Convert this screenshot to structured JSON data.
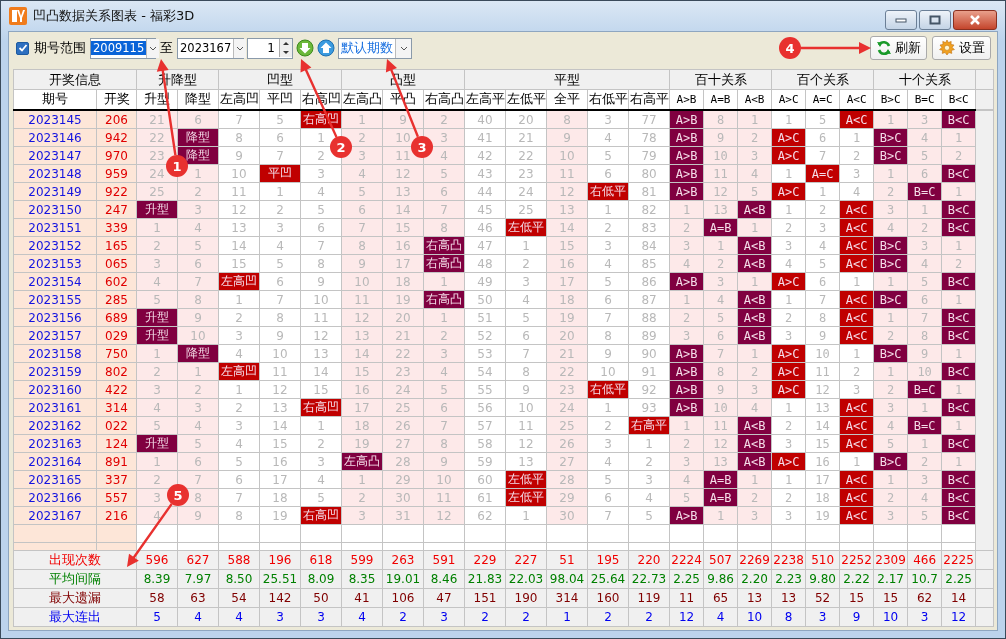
{
  "window": {
    "title": "凹凸数据关系图表 - 福彩3D"
  },
  "toolbar": {
    "range_enabled": true,
    "range_label": "期号范围",
    "start": {
      "value": "2009115",
      "highlighted": true
    },
    "to_label": "至",
    "end": {
      "value": "2023167"
    },
    "step": "1",
    "preset": "默认期数",
    "buttons": [
      {
        "label": "刷新",
        "kind": "refresh"
      },
      {
        "label": "设置",
        "kind": "settings"
      }
    ]
  },
  "table": {
    "groups": [
      {
        "label": "开奖信息",
        "kind": "info",
        "columns": [
          {
            "label": "期号",
            "shaded": true
          },
          {
            "label": "开奖",
            "shaded": true
          }
        ]
      },
      {
        "label": "升降型",
        "kind": "pattern",
        "color": "#800040",
        "columns": [
          {
            "label": "升型",
            "shaded": true
          },
          {
            "label": "降型",
            "shaded": true
          }
        ]
      },
      {
        "label": "凹型",
        "kind": "pattern",
        "color": "#c00000",
        "columns": [
          {
            "label": "左高凹",
            "shaded": false
          },
          {
            "label": "平凹",
            "shaded": false
          },
          {
            "label": "右高凹",
            "shaded": false
          }
        ]
      },
      {
        "label": "凸型",
        "kind": "pattern",
        "color": "#800040",
        "columns": [
          {
            "label": "左高凸",
            "shaded": true
          },
          {
            "label": "平凸",
            "shaded": true
          },
          {
            "label": "右高凸",
            "shaded": true
          }
        ]
      },
      {
        "label": "平型",
        "kind": "pattern",
        "color": "#c00000",
        "columns": [
          {
            "label": "左高平",
            "shaded": false
          },
          {
            "label": "左低平",
            "shaded": false
          },
          {
            "label": "全平",
            "shaded": true
          },
          {
            "label": "右低平",
            "shaded": false
          },
          {
            "label": "右高平",
            "shaded": false
          }
        ]
      },
      {
        "label": "百十关系",
        "kind": "pattern",
        "color": "#800040",
        "columns": [
          {
            "label": "A>B",
            "shaded": true
          },
          {
            "label": "A=B",
            "shaded": true
          },
          {
            "label": "A<B",
            "shaded": true
          }
        ]
      },
      {
        "label": "百个关系",
        "kind": "pattern",
        "color": "#c00000",
        "columns": [
          {
            "label": "A>C",
            "shaded": false
          },
          {
            "label": "A=C",
            "shaded": false
          },
          {
            "label": "A<C",
            "shaded": false
          }
        ]
      },
      {
        "label": "十个关系",
        "kind": "pattern",
        "color": "#800040",
        "columns": [
          {
            "label": "B>C",
            "shaded": true
          },
          {
            "label": "B=C",
            "shaded": true
          },
          {
            "label": "B<C",
            "shaded": true
          }
        ]
      }
    ],
    "rows": [
      {
        "period": "2023145",
        "draw": "206",
        "cells": [
          "21",
          "6",
          "7",
          "5",
          "右高凹",
          "1",
          "9",
          "2",
          "40",
          "20",
          "8",
          "3",
          "77",
          "A>B",
          "8",
          "1",
          "1",
          "5",
          "A<C",
          "1",
          "3",
          "B<C"
        ],
        "hits": [
          false,
          false,
          false,
          false,
          true,
          false,
          false,
          false,
          false,
          false,
          false,
          false,
          false,
          true,
          false,
          false,
          false,
          false,
          true,
          false,
          false,
          true
        ]
      },
      {
        "period": "2023146",
        "draw": "942",
        "cells": [
          "22",
          "降型",
          "8",
          "6",
          "1",
          "2",
          "10",
          "3",
          "41",
          "21",
          "9",
          "4",
          "78",
          "A>B",
          "9",
          "2",
          "A>C",
          "6",
          "1",
          "B>C",
          "4",
          "1"
        ],
        "hits": [
          false,
          true,
          false,
          false,
          false,
          false,
          false,
          false,
          false,
          false,
          false,
          false,
          false,
          true,
          false,
          false,
          true,
          false,
          false,
          true,
          false,
          false
        ]
      },
      {
        "period": "2023147",
        "draw": "970",
        "cells": [
          "23",
          "降型",
          "9",
          "7",
          "2",
          "3",
          "11",
          "4",
          "42",
          "22",
          "10",
          "5",
          "79",
          "A>B",
          "10",
          "3",
          "A>C",
          "7",
          "2",
          "B>C",
          "5",
          "2"
        ],
        "hits": [
          false,
          true,
          false,
          false,
          false,
          false,
          false,
          false,
          false,
          false,
          false,
          false,
          false,
          true,
          false,
          false,
          true,
          false,
          false,
          true,
          false,
          false
        ]
      },
      {
        "period": "2023148",
        "draw": "959",
        "cells": [
          "24",
          "1",
          "10",
          "平凹",
          "3",
          "4",
          "12",
          "5",
          "43",
          "23",
          "11",
          "6",
          "80",
          "A>B",
          "11",
          "4",
          "1",
          "A=C",
          "3",
          "1",
          "6",
          "B<C"
        ],
        "hits": [
          false,
          false,
          false,
          true,
          false,
          false,
          false,
          false,
          false,
          false,
          false,
          false,
          false,
          true,
          false,
          false,
          false,
          true,
          false,
          false,
          false,
          true
        ]
      },
      {
        "period": "2023149",
        "draw": "922",
        "cells": [
          "25",
          "2",
          "11",
          "1",
          "4",
          "5",
          "13",
          "6",
          "44",
          "24",
          "12",
          "右低平",
          "81",
          "A>B",
          "12",
          "5",
          "A>C",
          "1",
          "4",
          "2",
          "B=C",
          "1"
        ],
        "hits": [
          false,
          false,
          false,
          false,
          false,
          false,
          false,
          false,
          false,
          false,
          false,
          true,
          false,
          true,
          false,
          false,
          true,
          false,
          false,
          false,
          true,
          false
        ]
      },
      {
        "period": "2023150",
        "draw": "247",
        "cells": [
          "升型",
          "3",
          "12",
          "2",
          "5",
          "6",
          "14",
          "7",
          "45",
          "25",
          "13",
          "1",
          "82",
          "1",
          "13",
          "A<B",
          "1",
          "2",
          "A<C",
          "3",
          "1",
          "B<C"
        ],
        "hits": [
          true,
          false,
          false,
          false,
          false,
          false,
          false,
          false,
          false,
          false,
          false,
          false,
          false,
          false,
          false,
          true,
          false,
          false,
          true,
          false,
          false,
          true
        ]
      },
      {
        "period": "2023151",
        "draw": "339",
        "cells": [
          "1",
          "4",
          "13",
          "3",
          "6",
          "7",
          "15",
          "8",
          "46",
          "左低平",
          "14",
          "2",
          "83",
          "2",
          "A=B",
          "1",
          "2",
          "3",
          "A<C",
          "4",
          "2",
          "B<C"
        ],
        "hits": [
          false,
          false,
          false,
          false,
          false,
          false,
          false,
          false,
          false,
          true,
          false,
          false,
          false,
          false,
          true,
          false,
          false,
          false,
          true,
          false,
          false,
          true
        ]
      },
      {
        "period": "2023152",
        "draw": "165",
        "cells": [
          "2",
          "5",
          "14",
          "4",
          "7",
          "8",
          "16",
          "右高凸",
          "47",
          "1",
          "15",
          "3",
          "84",
          "3",
          "1",
          "A<B",
          "3",
          "4",
          "A<C",
          "B>C",
          "3",
          "1"
        ],
        "hits": [
          false,
          false,
          false,
          false,
          false,
          false,
          false,
          true,
          false,
          false,
          false,
          false,
          false,
          false,
          false,
          true,
          false,
          false,
          true,
          true,
          false,
          false
        ]
      },
      {
        "period": "2023153",
        "draw": "065",
        "cells": [
          "3",
          "6",
          "15",
          "5",
          "8",
          "9",
          "17",
          "右高凸",
          "48",
          "2",
          "16",
          "4",
          "85",
          "4",
          "2",
          "A<B",
          "4",
          "5",
          "A<C",
          "B>C",
          "4",
          "2"
        ],
        "hits": [
          false,
          false,
          false,
          false,
          false,
          false,
          false,
          true,
          false,
          false,
          false,
          false,
          false,
          false,
          false,
          true,
          false,
          false,
          true,
          true,
          false,
          false
        ]
      },
      {
        "period": "2023154",
        "draw": "602",
        "cells": [
          "4",
          "7",
          "左高凹",
          "6",
          "9",
          "10",
          "18",
          "1",
          "49",
          "3",
          "17",
          "5",
          "86",
          "A>B",
          "3",
          "1",
          "A>C",
          "6",
          "1",
          "1",
          "5",
          "B<C"
        ],
        "hits": [
          false,
          false,
          true,
          false,
          false,
          false,
          false,
          false,
          false,
          false,
          false,
          false,
          false,
          true,
          false,
          false,
          true,
          false,
          false,
          false,
          false,
          true
        ]
      },
      {
        "period": "2023155",
        "draw": "285",
        "cells": [
          "5",
          "8",
          "1",
          "7",
          "10",
          "11",
          "19",
          "右高凸",
          "50",
          "4",
          "18",
          "6",
          "87",
          "1",
          "4",
          "A<B",
          "1",
          "7",
          "A<C",
          "B>C",
          "6",
          "1"
        ],
        "hits": [
          false,
          false,
          false,
          false,
          false,
          false,
          false,
          true,
          false,
          false,
          false,
          false,
          false,
          false,
          false,
          true,
          false,
          false,
          true,
          true,
          false,
          false
        ]
      },
      {
        "period": "2023156",
        "draw": "689",
        "cells": [
          "升型",
          "9",
          "2",
          "8",
          "11",
          "12",
          "20",
          "1",
          "51",
          "5",
          "19",
          "7",
          "88",
          "2",
          "5",
          "A<B",
          "2",
          "8",
          "A<C",
          "1",
          "7",
          "B<C"
        ],
        "hits": [
          true,
          false,
          false,
          false,
          false,
          false,
          false,
          false,
          false,
          false,
          false,
          false,
          false,
          false,
          false,
          true,
          false,
          false,
          true,
          false,
          false,
          true
        ]
      },
      {
        "period": "2023157",
        "draw": "029",
        "cells": [
          "升型",
          "10",
          "3",
          "9",
          "12",
          "13",
          "21",
          "2",
          "52",
          "6",
          "20",
          "8",
          "89",
          "3",
          "6",
          "A<B",
          "3",
          "9",
          "A<C",
          "2",
          "8",
          "B<C"
        ],
        "hits": [
          true,
          false,
          false,
          false,
          false,
          false,
          false,
          false,
          false,
          false,
          false,
          false,
          false,
          false,
          false,
          true,
          false,
          false,
          true,
          false,
          false,
          true
        ]
      },
      {
        "period": "2023158",
        "draw": "750",
        "cells": [
          "1",
          "降型",
          "4",
          "10",
          "13",
          "14",
          "22",
          "3",
          "53",
          "7",
          "21",
          "9",
          "90",
          "A>B",
          "7",
          "1",
          "A>C",
          "10",
          "1",
          "B>C",
          "9",
          "1"
        ],
        "hits": [
          false,
          true,
          false,
          false,
          false,
          false,
          false,
          false,
          false,
          false,
          false,
          false,
          false,
          true,
          false,
          false,
          true,
          false,
          false,
          true,
          false,
          false
        ]
      },
      {
        "period": "2023159",
        "draw": "802",
        "cells": [
          "2",
          "1",
          "左高凹",
          "11",
          "14",
          "15",
          "23",
          "4",
          "54",
          "8",
          "22",
          "10",
          "91",
          "A>B",
          "8",
          "2",
          "A>C",
          "11",
          "2",
          "1",
          "10",
          "B<C"
        ],
        "hits": [
          false,
          false,
          true,
          false,
          false,
          false,
          false,
          false,
          false,
          false,
          false,
          false,
          false,
          true,
          false,
          false,
          true,
          false,
          false,
          false,
          false,
          true
        ]
      },
      {
        "period": "2023160",
        "draw": "422",
        "cells": [
          "3",
          "2",
          "1",
          "12",
          "15",
          "16",
          "24",
          "5",
          "55",
          "9",
          "23",
          "右低平",
          "92",
          "A>B",
          "9",
          "3",
          "A>C",
          "12",
          "3",
          "2",
          "B=C",
          "1"
        ],
        "hits": [
          false,
          false,
          false,
          false,
          false,
          false,
          false,
          false,
          false,
          false,
          false,
          true,
          false,
          true,
          false,
          false,
          true,
          false,
          false,
          false,
          true,
          false
        ]
      },
      {
        "period": "2023161",
        "draw": "314",
        "cells": [
          "4",
          "3",
          "2",
          "13",
          "右高凹",
          "17",
          "25",
          "6",
          "56",
          "10",
          "24",
          "1",
          "93",
          "A>B",
          "10",
          "4",
          "1",
          "13",
          "A<C",
          "3",
          "1",
          "B<C"
        ],
        "hits": [
          false,
          false,
          false,
          false,
          true,
          false,
          false,
          false,
          false,
          false,
          false,
          false,
          false,
          true,
          false,
          false,
          false,
          false,
          true,
          false,
          false,
          true
        ]
      },
      {
        "period": "2023162",
        "draw": "022",
        "cells": [
          "5",
          "4",
          "3",
          "14",
          "1",
          "18",
          "26",
          "7",
          "57",
          "11",
          "25",
          "2",
          "右高平",
          "1",
          "11",
          "A<B",
          "2",
          "14",
          "A<C",
          "4",
          "B=C",
          "1"
        ],
        "hits": [
          false,
          false,
          false,
          false,
          false,
          false,
          false,
          false,
          false,
          false,
          false,
          false,
          true,
          false,
          false,
          true,
          false,
          false,
          true,
          false,
          true,
          false
        ]
      },
      {
        "period": "2023163",
        "draw": "124",
        "cells": [
          "升型",
          "5",
          "4",
          "15",
          "2",
          "19",
          "27",
          "8",
          "58",
          "12",
          "26",
          "3",
          "1",
          "2",
          "12",
          "A<B",
          "3",
          "15",
          "A<C",
          "5",
          "1",
          "B<C"
        ],
        "hits": [
          true,
          false,
          false,
          false,
          false,
          false,
          false,
          false,
          false,
          false,
          false,
          false,
          false,
          false,
          false,
          true,
          false,
          false,
          true,
          false,
          false,
          true
        ]
      },
      {
        "period": "2023164",
        "draw": "891",
        "cells": [
          "1",
          "6",
          "5",
          "16",
          "3",
          "左高凸",
          "28",
          "9",
          "59",
          "13",
          "27",
          "4",
          "2",
          "3",
          "13",
          "A<B",
          "A>C",
          "16",
          "1",
          "B>C",
          "2",
          "1"
        ],
        "hits": [
          false,
          false,
          false,
          false,
          false,
          true,
          false,
          false,
          false,
          false,
          false,
          false,
          false,
          false,
          false,
          true,
          true,
          false,
          false,
          true,
          false,
          false
        ]
      },
      {
        "period": "2023165",
        "draw": "337",
        "cells": [
          "2",
          "7",
          "6",
          "17",
          "4",
          "1",
          "29",
          "10",
          "60",
          "左低平",
          "28",
          "5",
          "3",
          "4",
          "A=B",
          "1",
          "1",
          "17",
          "A<C",
          "1",
          "3",
          "B<C"
        ],
        "hits": [
          false,
          false,
          false,
          false,
          false,
          false,
          false,
          false,
          false,
          true,
          false,
          false,
          false,
          false,
          true,
          false,
          false,
          false,
          true,
          false,
          false,
          true
        ]
      },
      {
        "period": "2023166",
        "draw": "557",
        "cells": [
          "3",
          "8",
          "7",
          "18",
          "5",
          "2",
          "30",
          "11",
          "61",
          "左低平",
          "29",
          "6",
          "4",
          "5",
          "A=B",
          "2",
          "2",
          "18",
          "A<C",
          "2",
          "4",
          "B<C"
        ],
        "hits": [
          false,
          false,
          false,
          false,
          false,
          false,
          false,
          false,
          false,
          true,
          false,
          false,
          false,
          false,
          true,
          false,
          false,
          false,
          true,
          false,
          false,
          true
        ]
      },
      {
        "period": "2023167",
        "draw": "216",
        "cells": [
          "4",
          "9",
          "8",
          "19",
          "右高凹",
          "3",
          "31",
          "12",
          "62",
          "1",
          "30",
          "7",
          "5",
          "A>B",
          "1",
          "3",
          "3",
          "19",
          "A<C",
          "3",
          "5",
          "B<C"
        ],
        "hits": [
          false,
          false,
          false,
          false,
          true,
          false,
          false,
          false,
          false,
          false,
          false,
          false,
          false,
          true,
          false,
          false,
          false,
          false,
          true,
          false,
          false,
          true
        ]
      }
    ],
    "stats": [
      {
        "label": "出现次数",
        "kind": "count",
        "values": [
          "596",
          "627",
          "588",
          "196",
          "618",
          "599",
          "263",
          "591",
          "229",
          "227",
          "51",
          "195",
          "220",
          "2224",
          "507",
          "2269",
          "2238",
          "510",
          "2252",
          "2309",
          "466",
          "2225"
        ]
      },
      {
        "label": "平均间隔",
        "kind": "average",
        "values": [
          "8.39",
          "7.97",
          "8.50",
          "25.51",
          "8.09",
          "8.35",
          "19.01",
          "8.46",
          "21.83",
          "22.03",
          "98.04",
          "25.64",
          "22.73",
          "2.25",
          "9.86",
          "2.20",
          "2.23",
          "9.80",
          "2.22",
          "2.17",
          "10.7",
          "2.25"
        ]
      },
      {
        "label": "最大遗漏",
        "kind": "max_miss",
        "values": [
          "58",
          "63",
          "54",
          "142",
          "50",
          "41",
          "106",
          "47",
          "151",
          "190",
          "314",
          "160",
          "119",
          "11",
          "65",
          "13",
          "13",
          "52",
          "15",
          "15",
          "62",
          "14"
        ]
      },
      {
        "label": "最大连出",
        "kind": "max_streak",
        "values": [
          "5",
          "4",
          "4",
          "3",
          "3",
          "4",
          "2",
          "3",
          "2",
          "2",
          "1",
          "2",
          "2",
          "12",
          "4",
          "10",
          "8",
          "3",
          "9",
          "10",
          "3",
          "12"
        ]
      }
    ]
  },
  "callouts": [
    {
      "number": "1"
    },
    {
      "number": "2"
    },
    {
      "number": "3"
    },
    {
      "number": "4"
    },
    {
      "number": "5"
    }
  ]
}
